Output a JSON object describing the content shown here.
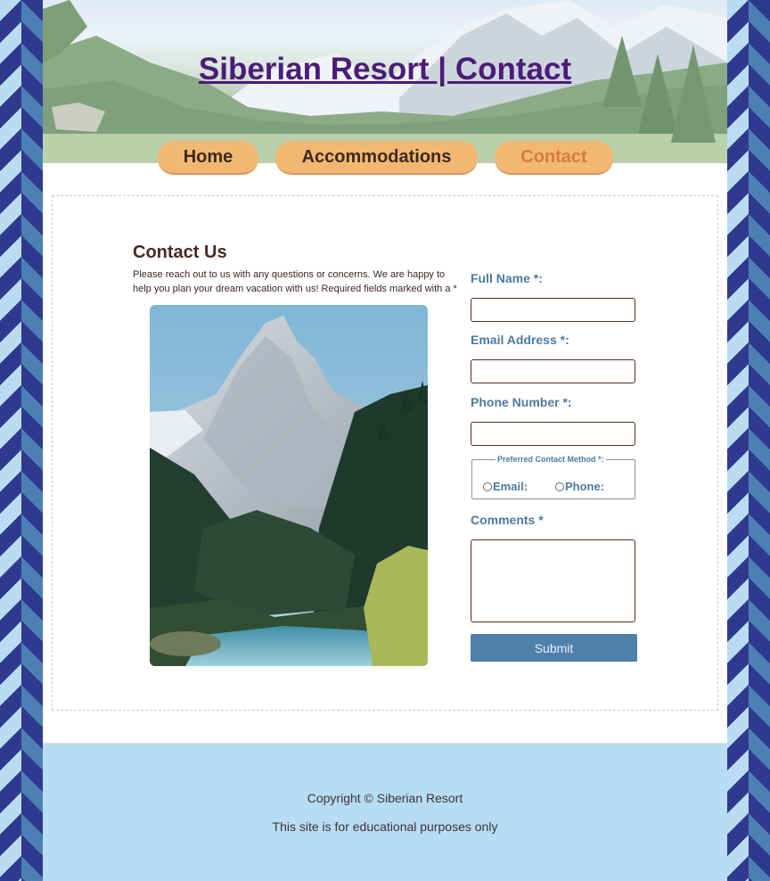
{
  "header": {
    "title": "Siberian Resort | Contact"
  },
  "nav": {
    "items": [
      {
        "label": "Home",
        "active": false
      },
      {
        "label": "Accommodations",
        "active": false
      },
      {
        "label": "Contact",
        "active": true
      }
    ]
  },
  "contact": {
    "heading": "Contact Us",
    "intro": "Please reach out to us with any questions or concerns. We are happy to help you plan your dream vacation with us! Required fields marked with a *"
  },
  "form": {
    "full_name_label": "Full Name *:",
    "full_name_value": "",
    "email_label": "Email Address *:",
    "email_value": "",
    "phone_label": "Phone Number *:",
    "phone_value": "",
    "preferred_legend": "Preferred Contact Method *:",
    "radio_email": "Email:",
    "radio_phone": "Phone:",
    "comments_label": "Comments *",
    "comments_value": "",
    "submit_label": "Submit"
  },
  "footer": {
    "copyright": "Copyright © Siberian Resort",
    "note": "This site is for educational purposes only"
  },
  "colors": {
    "nav_button": "#f2b873",
    "nav_active_text": "#d77a43",
    "title": "#4b1c7a",
    "label": "#4c7aa0",
    "submit": "#4f80ab",
    "footer_bg": "#b7dcf3"
  }
}
